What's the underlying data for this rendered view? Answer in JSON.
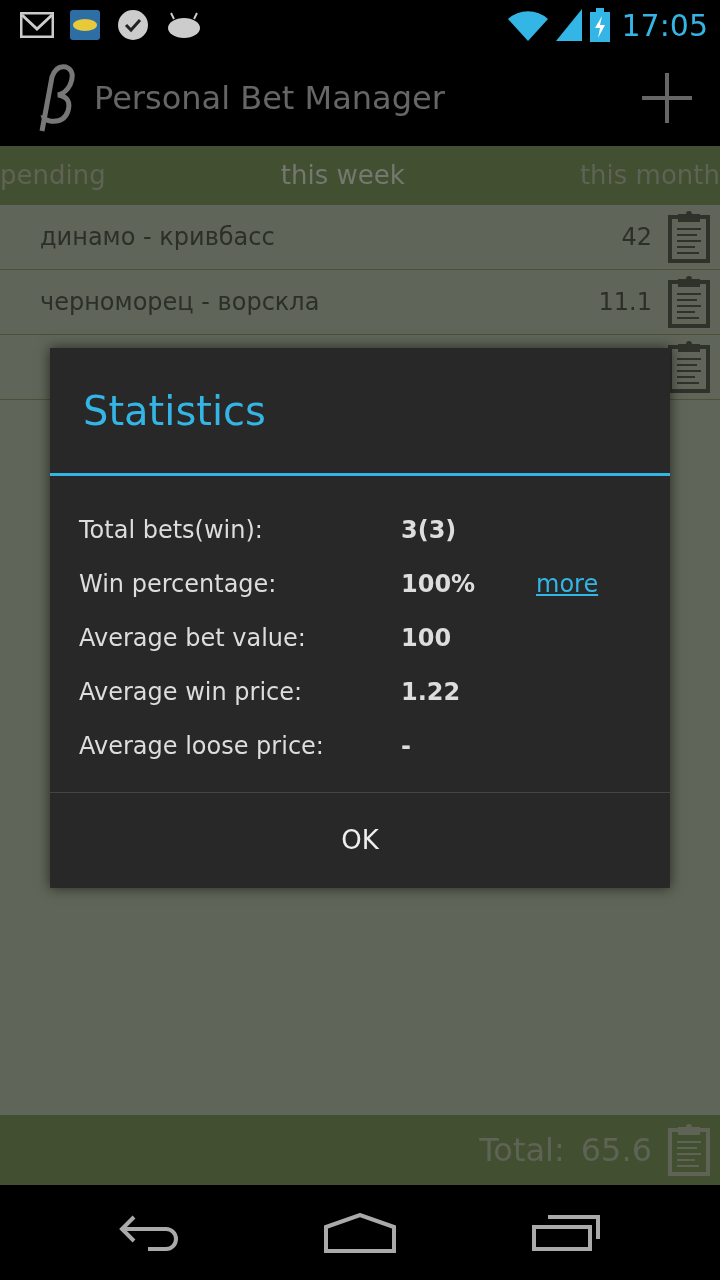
{
  "status_bar": {
    "time": "17:05"
  },
  "action_bar": {
    "title": "Personal Bet Manager"
  },
  "tabs": [
    {
      "label": "pending",
      "selected": false
    },
    {
      "label": "this week",
      "selected": true
    },
    {
      "label": "this month",
      "selected": false
    }
  ],
  "bets": [
    {
      "kind": "bet",
      "match": "динамо - кривбасс",
      "value": "42"
    },
    {
      "kind": "bet",
      "match": "черноморец - ворскла",
      "value": "11.1"
    },
    {
      "kind": "covered"
    }
  ],
  "footer": {
    "label": "Total:",
    "value": "65.6"
  },
  "dialog": {
    "title": "Statistics",
    "rows": [
      {
        "label": "Total bets(win):",
        "value": "3(3)"
      },
      {
        "label": "Win percentage:",
        "value": "100%",
        "link": "more"
      },
      {
        "label": "Average bet value:",
        "value": "100"
      },
      {
        "label": "Average win price:",
        "value": "1.22"
      },
      {
        "label": "Average loose price:",
        "value": "-"
      }
    ],
    "button": "OK"
  }
}
